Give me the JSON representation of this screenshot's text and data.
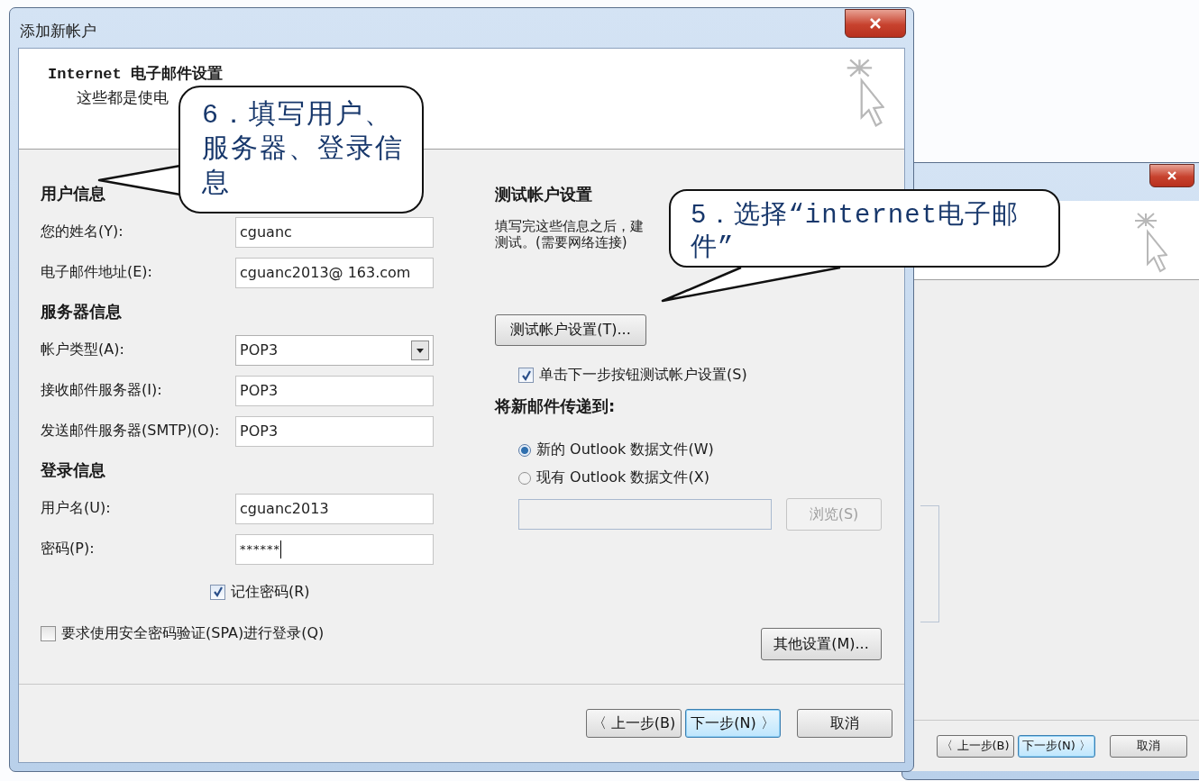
{
  "background_window": {
    "buttons": [
      {
        "label": "〈 上一步(B)",
        "default": false
      },
      {
        "label": "下一步(N) 〉",
        "default": true
      },
      {
        "label": "取消",
        "default": false
      }
    ]
  },
  "dialog": {
    "title": "添加新帐户",
    "header_title": "Internet 电子邮件设置",
    "header_subtitle": "这些都是使电",
    "left_rows": [
      {
        "kind": "heading",
        "text": "用户信息"
      },
      {
        "kind": "text_field",
        "label": "您的姓名(Y):",
        "value": "cguanc"
      },
      {
        "kind": "text_field",
        "label": "电子邮件地址(E):",
        "value": "cguanc2013@ 163.com"
      },
      {
        "kind": "heading",
        "text": "服务器信息"
      },
      {
        "kind": "dropdown",
        "label": "帐户类型(A):",
        "value": "POP3"
      },
      {
        "kind": "text_field",
        "label": "接收邮件服务器(I):",
        "value": "POP3"
      },
      {
        "kind": "text_field",
        "label": "发送邮件服务器(SMTP)(O):",
        "value": "POP3"
      },
      {
        "kind": "heading",
        "text": "登录信息"
      },
      {
        "kind": "text_field",
        "label": "用户名(U):",
        "value": "cguanc2013"
      },
      {
        "kind": "password_field",
        "label": "密码(P):",
        "value": "******"
      }
    ],
    "remember_password": {
      "label": "记住密码(R)",
      "checked": true
    },
    "spa_login": {
      "label": "要求使用安全密码验证(SPA)进行登录(Q)",
      "checked": false
    },
    "test_section": {
      "heading": "测试帐户设置",
      "description": [
        "填写完这些信息之后，建",
        "测试。(需要网络连接)"
      ],
      "button": "测试帐户设置(T)...",
      "auto_test": {
        "label": "单击下一步按钮测试帐户设置(S)",
        "checked": true
      }
    },
    "delivery": {
      "heading": "将新邮件传递到:",
      "options": [
        {
          "label": "新的 Outlook 数据文件(W)",
          "selected": true
        },
        {
          "label": "现有 Outlook 数据文件(X)",
          "selected": false
        }
      ],
      "browse_button": {
        "label": "浏览(S)",
        "disabled": true
      }
    },
    "more_settings_button": "其他设置(M)...",
    "buttons": [
      {
        "label": "〈 上一步(B)",
        "default": false
      },
      {
        "label": "下一步(N) 〉",
        "default": true
      },
      {
        "label": "取消",
        "default": false
      }
    ]
  },
  "callouts": [
    {
      "text": "6．填写用户、服务器、登录信息"
    },
    {
      "text": "5．选择“internet电子邮件”"
    }
  ]
}
